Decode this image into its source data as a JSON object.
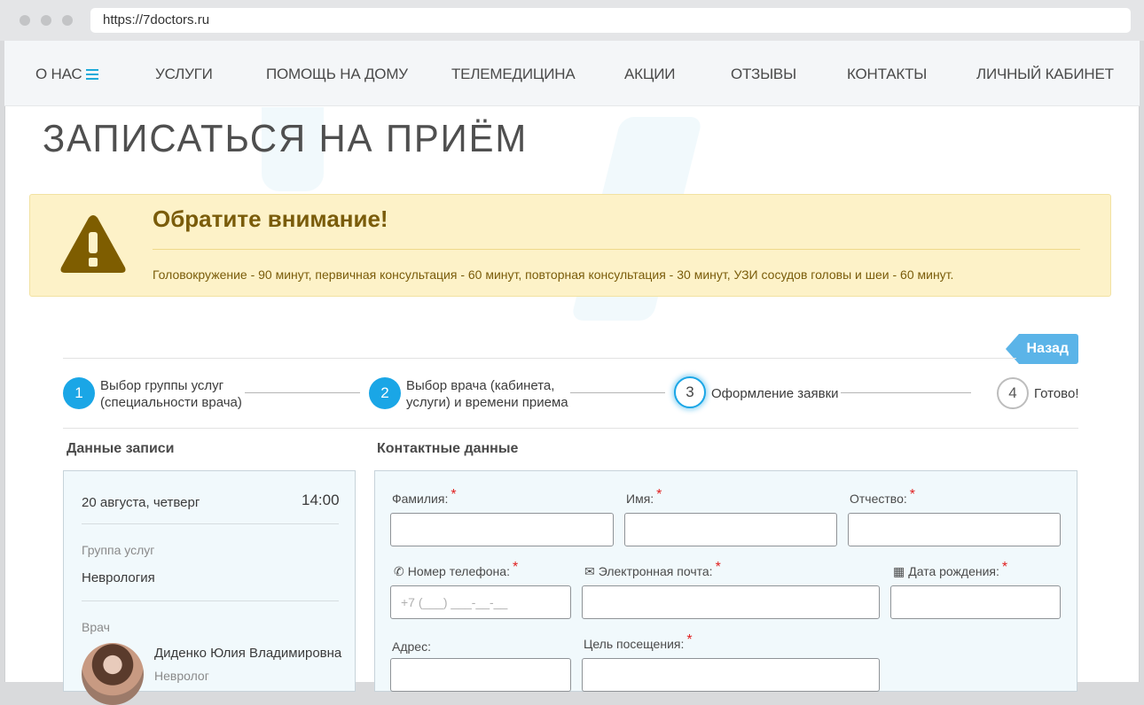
{
  "browser": {
    "url": "https://7doctors.ru"
  },
  "nav": {
    "about": "О НАС",
    "services": "УСЛУГИ",
    "home_help": "ПОМОЩЬ НА ДОМУ",
    "telemedicine": "ТЕЛЕМЕДИЦИНА",
    "promotions": "АКЦИИ",
    "reviews": "ОТЗЫВЫ",
    "contacts": "КОНТАКТЫ",
    "account": "ЛИЧНЫЙ КАБИНЕТ"
  },
  "page": {
    "title": "ЗАПИСАТЬСЯ НА ПРИЁМ"
  },
  "alert": {
    "title": "Обратите внимание!",
    "text": "Головокружение - 90 минут, первичная консультация - 60 минут, повторная консультация - 30 минут, УЗИ сосудов головы и шеи - 60 минут."
  },
  "back_button": "Назад",
  "steps": [
    {
      "num": "1",
      "line1": "Выбор группы услуг",
      "line2": "(специальности врача)",
      "state": "done"
    },
    {
      "num": "2",
      "line1": "Выбор врача (кабинета,",
      "line2": "услуги) и времени приема",
      "state": "done"
    },
    {
      "num": "3",
      "line1": "Оформление заявки",
      "line2": "",
      "state": "active"
    },
    {
      "num": "4",
      "line1": "Готово!",
      "line2": "",
      "state": "todo"
    }
  ],
  "booking": {
    "heading": "Данные записи",
    "date": "20 августа, четверг",
    "time": "14:00",
    "group_label": "Группа услуг",
    "group_value": "Неврология",
    "doctor_label": "Врач",
    "doctor_name": "Диденко Юлия Владимировна",
    "doctor_spec": "Невролог"
  },
  "contact": {
    "heading": "Контактные данные",
    "required_mark": "*",
    "surname_label": "Фамилия:",
    "name_label": "Имя:",
    "patronymic_label": "Отчество:",
    "phone_label": "Номер телефона:",
    "phone_placeholder": "+7 (___) ___-__-__",
    "email_label": "Электронная почта:",
    "birth_label": "Дата рождения:",
    "address_label": "Адрес:",
    "purpose_label": "Цель посещения:"
  },
  "colors": {
    "accent": "#1aa6e6",
    "alert_bg": "#fdf2c8",
    "alert_text": "#7a5c0a",
    "back_button": "#5bb4e8"
  },
  "icons": {
    "menu": "hamburger-icon",
    "warning": "warning-triangle-icon",
    "phone": "phone-icon",
    "email": "envelope-icon",
    "calendar": "calendar-icon"
  }
}
